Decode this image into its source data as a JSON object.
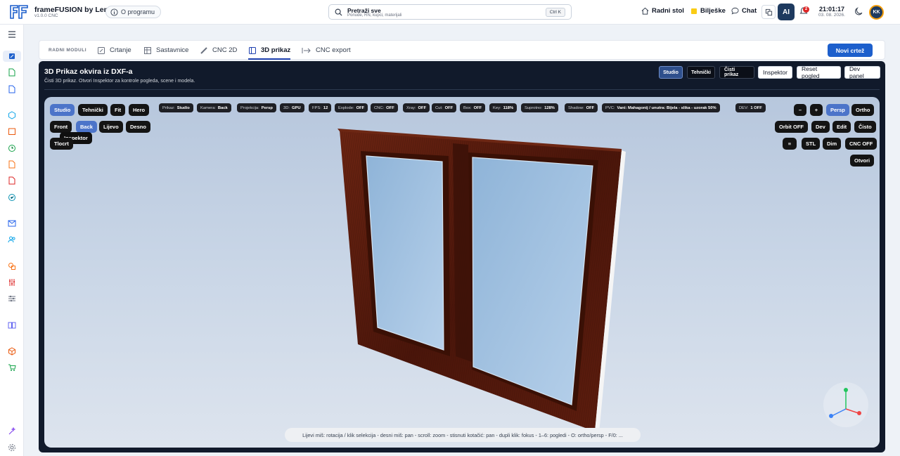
{
  "app": {
    "title": "frameFUSION by Lemy",
    "version": "v1.0.0 CNC",
    "about_label": "O programu"
  },
  "search": {
    "title": "Pretraži sve",
    "subtitle": "Ponude, RN, kupci, materijali",
    "shortcut": "Ctrl K"
  },
  "topnav": {
    "desk": "Radni stol",
    "notes": "Bilješke",
    "chat": "Chat",
    "ai": "AI",
    "notif_count": "2",
    "time": "21:01:17",
    "date": "03. 08. 2026.",
    "avatar": "KK"
  },
  "modules": {
    "label": "RADNI MODULI",
    "tabs": [
      {
        "label": "Crtanje",
        "icon": "pencil-square-icon"
      },
      {
        "label": "Sastavnice",
        "icon": "list-table-icon"
      },
      {
        "label": "CNC 2D",
        "icon": "ruler-icon"
      },
      {
        "label": "3D prikaz",
        "icon": "cube-view-icon",
        "active": true
      },
      {
        "label": "CNC export",
        "icon": "export-arrow-icon"
      }
    ],
    "new_button": "Novi crtež"
  },
  "panel": {
    "title": "3D Prikaz okvira iz DXF-a",
    "subtitle": "Čisti 3D prikaz. Otvori Inspektor za kontrole pogleda, scene i modela.",
    "header_buttons": [
      "Studio",
      "Tehnički",
      "Čisti prikaz",
      "Inspektor",
      "Reset pogled",
      "Dev panel"
    ]
  },
  "viewport": {
    "left_row1": [
      "Studio",
      "Tehnički",
      "Fit",
      "Hero"
    ],
    "left_row2": [
      "Front",
      "Back",
      "Lijevo",
      "Desno"
    ],
    "left_row3": [
      "Tlocrt"
    ],
    "hidden_tooltip": "Inspektor",
    "chips": [
      {
        "k": "Prikaz:",
        "v": "Studio"
      },
      {
        "k": "Kamera:",
        "v": "Back"
      },
      {
        "k": "Projekcija:",
        "v": "Persp"
      },
      {
        "k": "3D:",
        "v": "GPU"
      },
      {
        "k": "FPS:",
        "v": "12"
      },
      {
        "k": "Explode:",
        "v": "OFF"
      },
      {
        "k": "CNC:",
        "v": "OFF"
      },
      {
        "k": "Xray:",
        "v": "OFF"
      },
      {
        "k": "Cut:",
        "v": "OFF"
      },
      {
        "k": "Box:",
        "v": "OFF"
      },
      {
        "k": "Key:",
        "v": "118%"
      },
      {
        "k": "Suprotno:",
        "v": "128%"
      },
      {
        "k": "Shadow:",
        "v": "OFF"
      },
      {
        "k": "PVC:",
        "v": "Vani: Mahagonij / unutra: Bijela - slika - uzorak 50%"
      },
      {
        "k": "DEV:",
        "v": "1 OFF"
      }
    ],
    "right_row1": [
      "–",
      "+",
      "Persp",
      "Ortho"
    ],
    "right_row2": [
      "Orbit OFF",
      "Dev",
      "Edit",
      "Čisto"
    ],
    "right_row3": [
      "≡",
      "STL",
      "Dim",
      "CNC OFF"
    ],
    "right_row4": [
      "Otvori"
    ],
    "help": "Lijevi miš: rotacija / klik selekcija - desni miš: pan - scroll: zoom - stisnuti kotačić: pan - dupli klik: fokus - 1–6: pogledi - O: ortho/persp - F/0: ...",
    "colors": {
      "frame": "#5a1a0e",
      "glass": "#a9c7e6",
      "selected": "#4c74c9"
    }
  }
}
